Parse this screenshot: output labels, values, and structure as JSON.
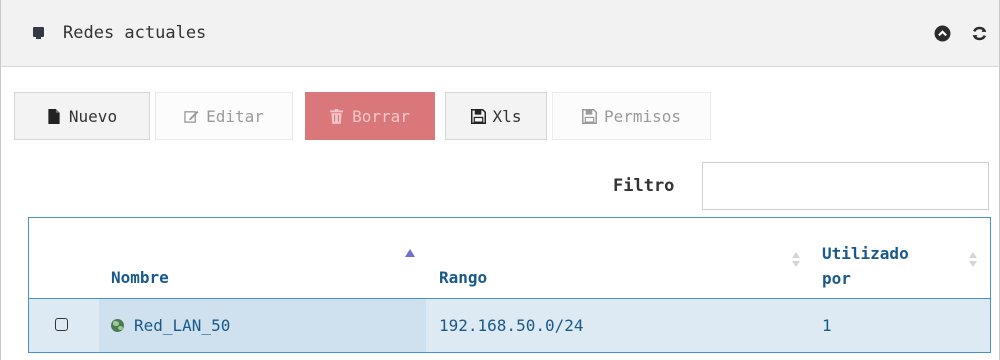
{
  "panel": {
    "title": "Redes actuales",
    "controls": {
      "collapse_icon": "chevron-up-circle-icon",
      "refresh_icon": "refresh-icon"
    }
  },
  "toolbar": {
    "new_label": "Nuevo",
    "edit_label": "Editar",
    "delete_label": "Borrar",
    "xls_label": "Xls",
    "permissions_label": "Permisos",
    "colors": {
      "delete_bg": "#d9777a",
      "disabled_text": "#9a9a9a"
    }
  },
  "filter": {
    "label": "Filtro",
    "value": "",
    "placeholder": ""
  },
  "table": {
    "columns": [
      "Nombre",
      "Rango",
      "Utilizado por"
    ],
    "column_used_line1": "Utilizado",
    "column_used_line2": "por",
    "sorted_column": "Nombre",
    "sort_direction": "ascending",
    "rows": [
      {
        "selected": false,
        "name": "Red_LAN_50",
        "range": "192.168.50.0/24",
        "used_by": "1"
      }
    ],
    "colors": {
      "header_text": "#1a5a8a",
      "border": "#4a90c9",
      "row_bg": "#dde9f3"
    }
  }
}
